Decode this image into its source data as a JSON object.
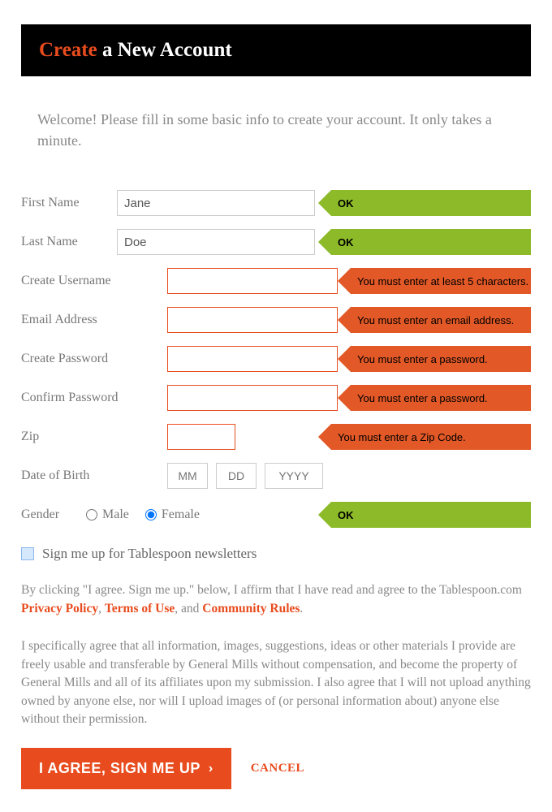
{
  "header": {
    "accent": "Create",
    "rest": " a New Account"
  },
  "welcome": "Welcome! Please fill in some basic info to create your account. It only takes a minute.",
  "fields": {
    "first_name": {
      "label": "First Name",
      "value": "Jane",
      "msg": "OK",
      "status": "ok"
    },
    "last_name": {
      "label": "Last Name",
      "value": "Doe",
      "msg": "OK",
      "status": "ok"
    },
    "username": {
      "label": "Create Username",
      "value": "",
      "msg": "You must enter at least 5 characters.",
      "status": "error"
    },
    "email": {
      "label": "Email Address",
      "value": "",
      "msg": "You must enter an email address.",
      "status": "error"
    },
    "password": {
      "label": "Create Password",
      "value": "",
      "msg": "You must enter a password.",
      "status": "error"
    },
    "confirm": {
      "label": "Confirm Password",
      "value": "",
      "msg": "You must enter a password.",
      "status": "error"
    },
    "zip": {
      "label": "Zip",
      "value": "",
      "msg": "You must enter a Zip Code.",
      "status": "error"
    },
    "dob": {
      "label": "Date of Birth",
      "mm": "MM",
      "dd": "DD",
      "yyyy": "YYYY"
    },
    "gender": {
      "label": "Gender",
      "male": "Male",
      "female": "Female",
      "selected": "female",
      "msg": "OK",
      "status": "ok"
    }
  },
  "newsletter": {
    "label": "Sign me up for Tablespoon newsletters",
    "checked": true
  },
  "legal": {
    "para1_prefix": "By clicking \"I agree. Sign me up.\" below, I affirm that I have read and agree to the Tablespoon.com ",
    "privacy": "Privacy Policy",
    "comma1": ", ",
    "terms": "Terms of Use",
    "comma2": ", and ",
    "community": "Community Rules",
    "period": ".",
    "para2": "I specifically agree that all information, images, suggestions, ideas or other materials I provide are freely usable and transferable by General Mills without compensation, and become the property of General Mills and all of its affiliates upon my submission. I also agree that I will not upload anything owned by anyone else, nor will I upload images of (or personal information about) anyone else without their permission."
  },
  "actions": {
    "primary": "I AGREE, SIGN ME UP",
    "cancel": "CANCEL"
  }
}
